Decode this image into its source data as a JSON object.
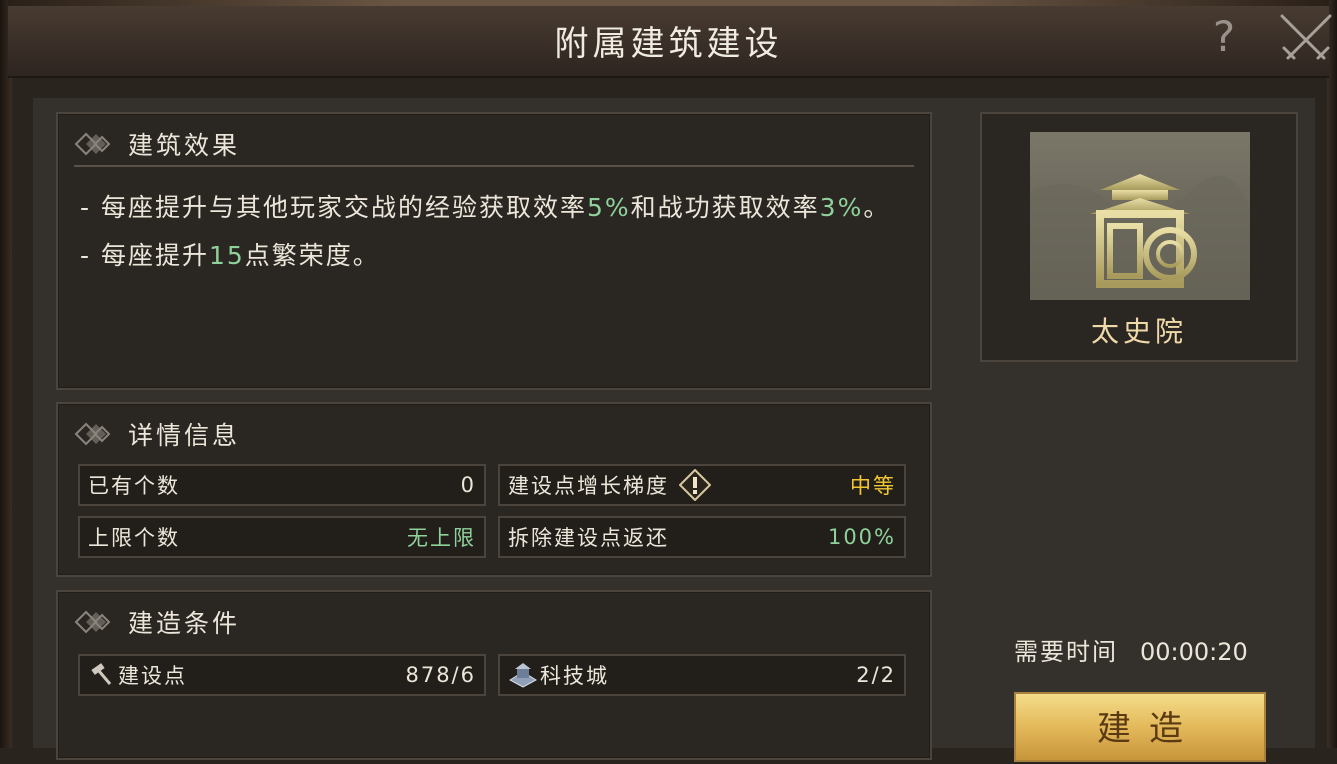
{
  "title": "附属建筑建设",
  "help_label": "?",
  "effects": {
    "header": "建筑效果",
    "line1_prefix": "- 每座提升与其他玩家交战的经验获取效率",
    "line1_value1": "5%",
    "line1_mid": "和战功获取效率",
    "line1_value2": "3%",
    "line1_suffix": "。",
    "line2_prefix": "- 每座提升",
    "line2_value": "15",
    "line2_suffix": "点繁荣度。"
  },
  "details": {
    "header": "详情信息",
    "owned_label": "已有个数",
    "owned_value": "0",
    "growth_label": "建设点增长梯度",
    "growth_value": "中等",
    "limit_label": "上限个数",
    "limit_value": "无上限",
    "refund_label": "拆除建设点返还",
    "refund_value": "100%"
  },
  "conditions": {
    "header": "建造条件",
    "points_label": "建设点",
    "points_value": "878/6",
    "tech_label": "科技城",
    "tech_value": "2/2"
  },
  "building": {
    "name": "太史院"
  },
  "time": {
    "label": "需要时间",
    "value": "00:00:20"
  },
  "build_button": "建造",
  "colors": {
    "highlight": "#8fd19a",
    "accent_yellow": "#f2c832",
    "button_gold": "#e3b95a"
  }
}
